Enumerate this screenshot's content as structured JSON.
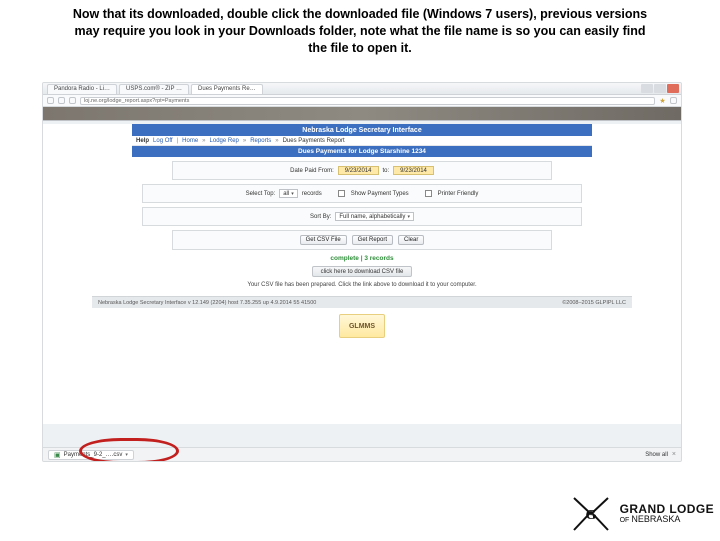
{
  "instruction": "Now that its downloaded, double click the downloaded file (Windows 7 users), previous versions may require you look in your Downloads folder, note what the file name is so you can easily find the file to open it.",
  "browser": {
    "tabs": [
      {
        "label": "Pandora Radio - Li…"
      },
      {
        "label": "USPS.com® - ZIP …"
      },
      {
        "label": "Dues Payments Re…"
      }
    ],
    "url": "loj.ne.org/lodge_report.aspx?rpt=Payments",
    "star_icon": "★",
    "close_icon": "×",
    "download_bar": {
      "file_icon": "▣",
      "filename": "Payments_9-2_….csv",
      "caret": "▾",
      "show_all": "Show all",
      "close": "×"
    }
  },
  "page": {
    "banner": "Nebraska Lodge Secretary Interface",
    "crumbs": {
      "help": "Help",
      "logoff": "Log Off",
      "home": "Home",
      "lodge_rep": "Lodge Rep",
      "reports": "Reports",
      "current": "Dues Payments Report"
    },
    "title": "Dues Payments for Lodge Starshine 1234",
    "dates": {
      "label_from": "Date Paid From:",
      "from": "9/23/2014",
      "label_to": "to:",
      "to": "9/23/2014"
    },
    "options": {
      "select_top_label": "Select Top:",
      "top_value": "all",
      "records_label": "records",
      "show_payment_types": "Show Payment Types",
      "printer_friendly": "Printer Friendly"
    },
    "sort": {
      "label": "Sort By:",
      "value": "Full name, alphabetically"
    },
    "buttons": {
      "csv": "Get CSV File",
      "report": "Get Report",
      "clear": "Clear"
    },
    "complete": "complete | 3 records",
    "download_link": "click here to download CSV file",
    "prepared": "Your CSV file has been prepared. Click the link above to download it to your computer.",
    "footer_left": "Nebraska Lodge Secretary Interface   v 12.149 (2204)   host 7.35.255   up 4.9.2014   55 41500",
    "footer_right": "©2008–2015 GLPIPL LLC",
    "badge": "GLMMS"
  },
  "brand": {
    "line1": "GRAND LODGE",
    "of": "OF",
    "line2": "NEBRASKA"
  }
}
